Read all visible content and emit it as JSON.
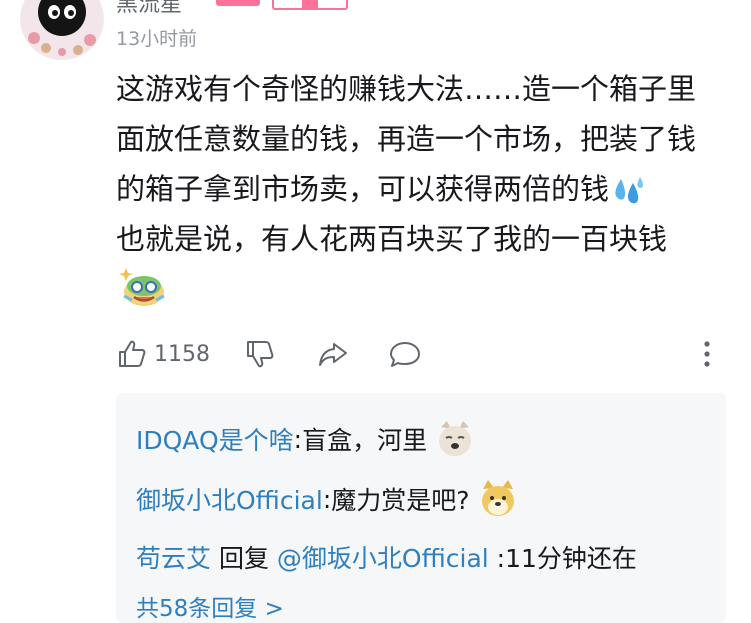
{
  "comment": {
    "username": "黑流星",
    "timestamp": "13小时前",
    "lines": [
      "这游戏有个奇怪的赚钱大法……造一个箱子里",
      "面放任意数量的钱，再造一个市场，把装了钱",
      "的箱子拿到市场卖，可以获得两倍的钱",
      "也就是说，有人花两百块买了我的一百块钱"
    ],
    "emotes": [
      "sweat-drops-emote",
      "laughing-crying-emote"
    ]
  },
  "actions": {
    "like_count": "1158",
    "icons": [
      "thumbs-up-icon",
      "thumbs-down-icon",
      "share-icon",
      "comment-icon",
      "more-vertical-icon"
    ]
  },
  "replies": [
    {
      "name": "IDQAQ是个啥",
      "separator": ": ",
      "text": "盲盒，河里",
      "emote": "doge-emote"
    },
    {
      "name": "御坂小北Official",
      "separator": ": ",
      "text": "魔力赏是吧?",
      "emote": "shiba-emote"
    },
    {
      "name": "苟云艾",
      "reply_word": " 回复 ",
      "mention": "@御坂小北Official",
      "text": " :11分钟还在"
    }
  ],
  "more_replies": "共58条回复 >",
  "colors": {
    "link": "#2f7fbf",
    "badge": "#fb7299",
    "reply_bg": "#f6f7f8",
    "muted": "#9499a0"
  }
}
